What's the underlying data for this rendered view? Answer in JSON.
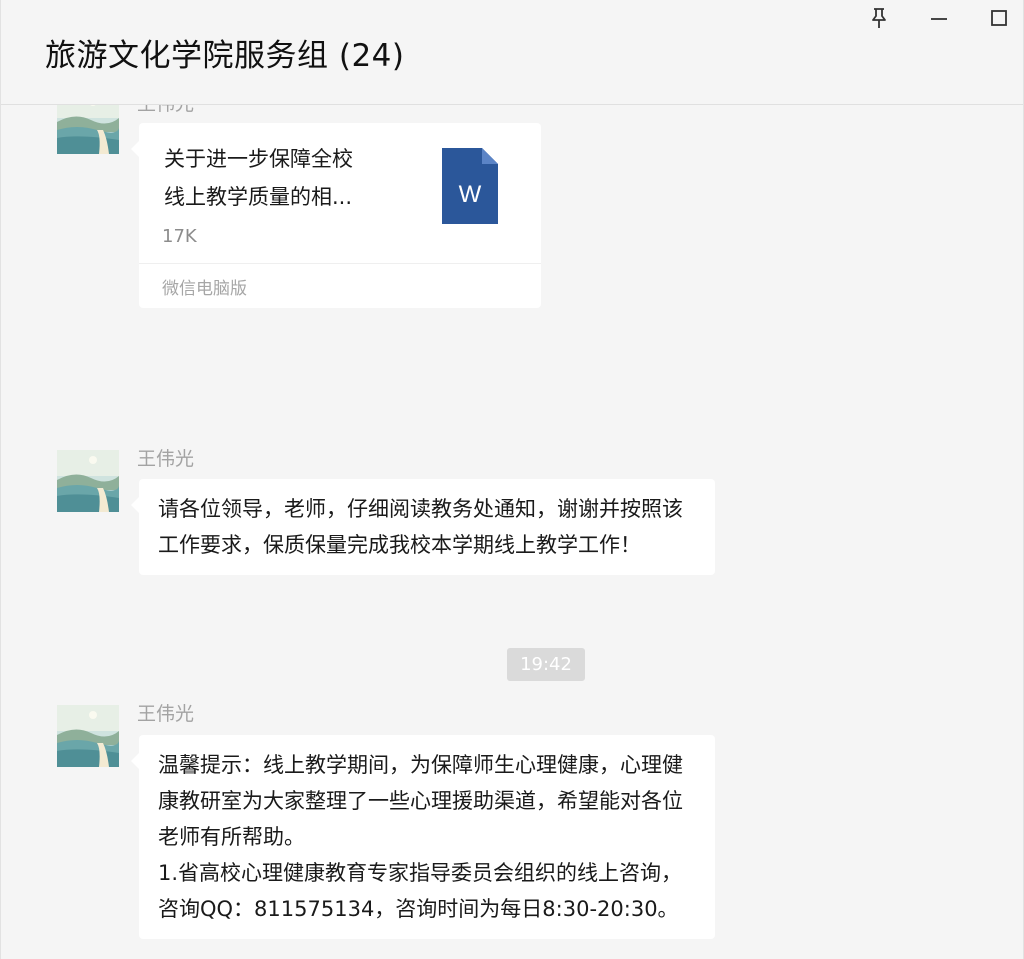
{
  "window": {
    "title": "旅游文化学院服务组 (24)",
    "controls": {
      "pin_icon": "pin-icon",
      "minimize_icon": "minimize-icon",
      "maximize_icon": "maximize-icon"
    }
  },
  "messages": [
    {
      "sender": "王伟光",
      "type": "file",
      "file": {
        "name": "关于进一步保障全校\n线上教学质量的相...",
        "size": "17K",
        "source": "微信电脑版",
        "icon": "word-doc-icon",
        "icon_letter": "W",
        "icon_color": "#2b579a"
      }
    },
    {
      "sender": "王伟光",
      "type": "text",
      "text": "请各位领导，老师，仔细阅读教务处通知，谢谢并按照该工作要求，保质保量完成我校本学期线上教学工作！"
    },
    {
      "type": "time",
      "text": "19:42"
    },
    {
      "sender": "王伟光",
      "type": "text",
      "text": "温馨提示：线上教学期间，为保障师生心理健康，心理健康教研室为大家整理了一些心理援助渠道，希望能对各位老师有所帮助。\n1.省高校心理健康教育专家指导委员会组织的线上咨询，咨询QQ：811575134，咨询时间为每日8:30-20:30。"
    }
  ],
  "colors": {
    "background": "#f5f5f5",
    "bubble": "#ffffff",
    "timestamp_bg": "#dadada",
    "word_blue": "#2b579a"
  }
}
